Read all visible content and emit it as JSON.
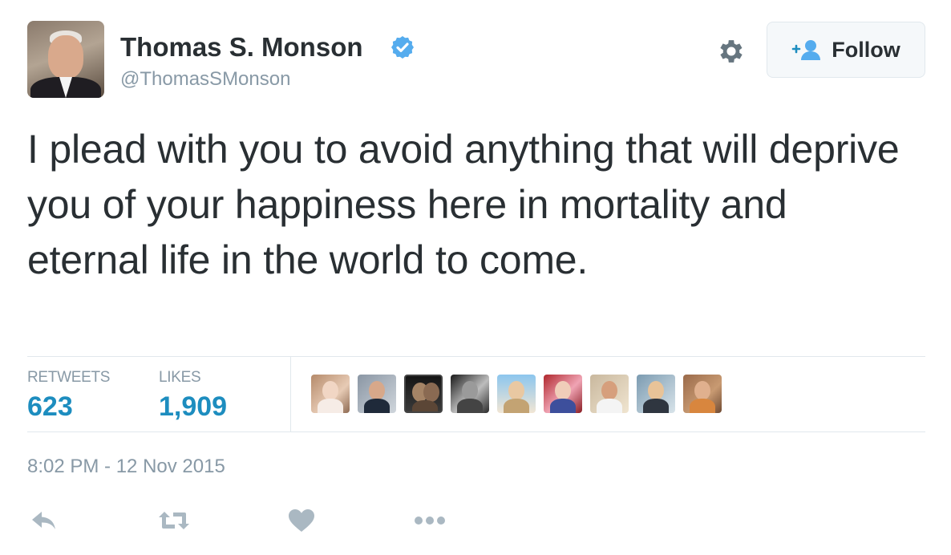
{
  "author": {
    "name": "Thomas S. Monson",
    "handle": "@ThomasSMonson",
    "verified_icon": "verified-badge-icon",
    "avatar_icon": "profile-avatar"
  },
  "header": {
    "settings_icon": "gear-icon",
    "follow_label": "Follow",
    "follow_icon": "add-user-icon"
  },
  "tweet": {
    "text": "I plead with you to avoid anything that will deprive you of your happiness here in mortality and eternal life in the world to come."
  },
  "stats": {
    "retweets_label": "RETWEETS",
    "retweets_value": "623",
    "likes_label": "LIKES",
    "likes_value": "1,909"
  },
  "likers": [
    {
      "icon": "liker-avatar-1"
    },
    {
      "icon": "liker-avatar-2"
    },
    {
      "icon": "liker-avatar-3"
    },
    {
      "icon": "liker-avatar-4"
    },
    {
      "icon": "liker-avatar-5"
    },
    {
      "icon": "liker-avatar-6"
    },
    {
      "icon": "liker-avatar-7"
    },
    {
      "icon": "liker-avatar-8"
    },
    {
      "icon": "liker-avatar-9"
    }
  ],
  "timestamp": "8:02 PM - 12 Nov 2015",
  "actions": {
    "reply_icon": "reply-icon",
    "retweet_icon": "retweet-icon",
    "like_icon": "heart-icon",
    "more_icon": "more-icon"
  },
  "colors": {
    "text": "#292f33",
    "muted": "#8899a6",
    "stat_value": "#1d8dbf",
    "verified": "#55acee",
    "action_icon": "#aab8c2",
    "border": "#e1e8ed"
  }
}
